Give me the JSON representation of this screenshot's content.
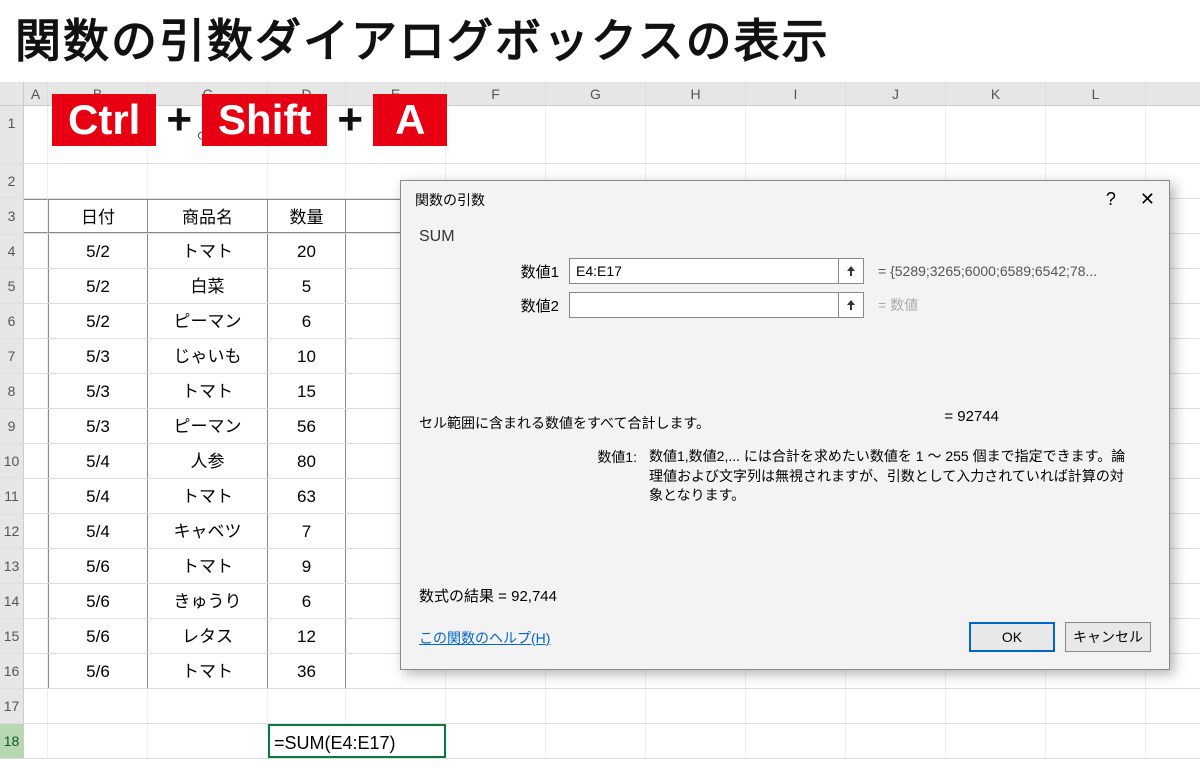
{
  "title": "関数の引数ダイアログボックスの表示",
  "shortcut": {
    "keys": [
      "Ctrl",
      "Shift",
      "A"
    ],
    "plus": "+"
  },
  "columns": [
    "A",
    "B",
    "C",
    "D",
    "E",
    "F",
    "G",
    "H",
    "I",
    "J",
    "K",
    "L"
  ],
  "row_numbers": [
    "1",
    "2",
    "3",
    "4",
    "5",
    "6",
    "7",
    "8",
    "9",
    "10",
    "11",
    "12",
    "13",
    "14",
    "15",
    "16",
    "17",
    "18"
  ],
  "hidden_char": "○○",
  "table": {
    "headers": [
      "日付",
      "商品名",
      "数量"
    ],
    "rows": [
      [
        "5/2",
        "トマト",
        "20"
      ],
      [
        "5/2",
        "白菜",
        "5"
      ],
      [
        "5/2",
        "ピーマン",
        "6"
      ],
      [
        "5/3",
        "じゃいも",
        "10"
      ],
      [
        "5/3",
        "トマト",
        "15"
      ],
      [
        "5/3",
        "ピーマン",
        "56"
      ],
      [
        "5/4",
        "人参",
        "80"
      ],
      [
        "5/4",
        "トマト",
        "63"
      ],
      [
        "5/4",
        "キャベツ",
        "7"
      ],
      [
        "5/6",
        "トマト",
        "9"
      ],
      [
        "5/6",
        "きゅうり",
        "6"
      ],
      [
        "5/6",
        "レタス",
        "12"
      ],
      [
        "5/6",
        "トマト",
        "36"
      ]
    ]
  },
  "formula_cell": "=SUM(E4:E17)",
  "dialog": {
    "title": "関数の引数",
    "help_icon": "?",
    "close_icon": "✕",
    "function": "SUM",
    "args": [
      {
        "label": "数値1",
        "value": "E4:E17",
        "result": "=  {5289;3265;6000;6589;6542;78..."
      },
      {
        "label": "数値2",
        "value": "",
        "result": "=  数値"
      }
    ],
    "total_result": "=  92744",
    "description": "セル範囲に含まれる数値をすべて合計します。",
    "arg_desc_label": "数値1:",
    "arg_desc_text": "数値1,数値2,... には合計を求めたい数値を 1 ～ 255 個まで指定できます。論理値および文字列は無視されますが、引数として入力されていれば計算の対象となります。",
    "formula_result": "数式の結果 =  92,744",
    "help_link": "この関数のヘルプ(H)",
    "ok": "OK",
    "cancel": "キャンセル"
  }
}
